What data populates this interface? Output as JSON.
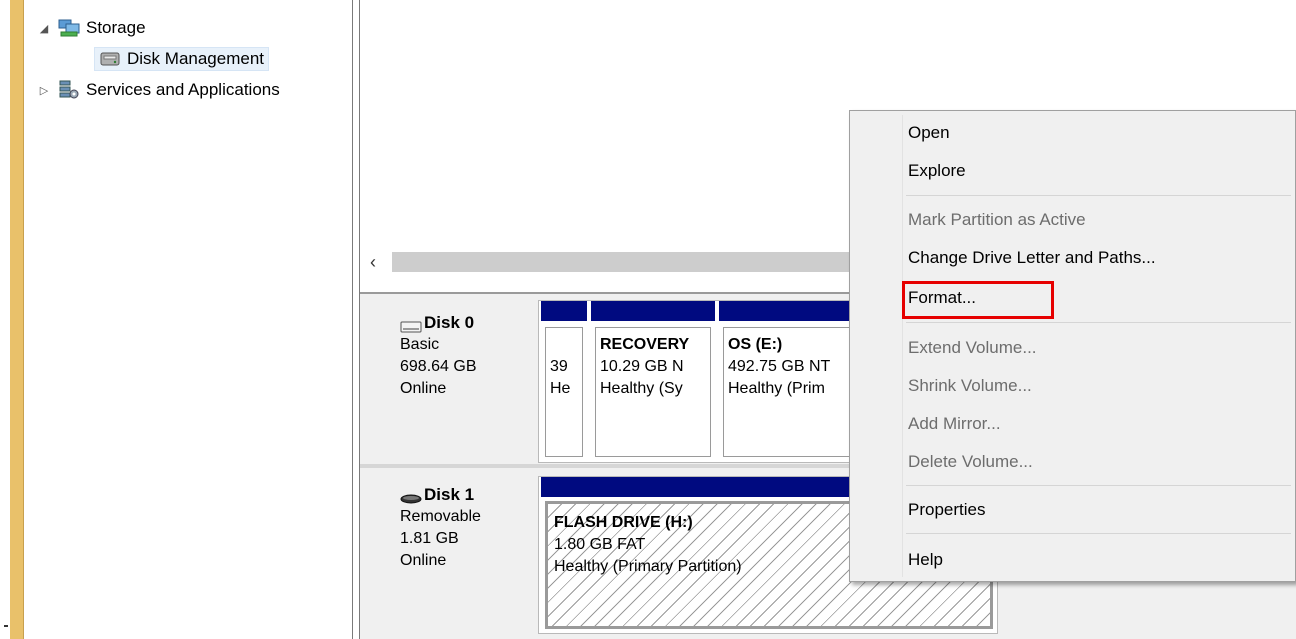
{
  "tree": {
    "items": [
      {
        "label": "Storage",
        "expander": "◢",
        "icon": "storage-icon"
      },
      {
        "label": "Disk Management",
        "icon": "disk-management-icon",
        "selected": true
      },
      {
        "label": "Services and Applications",
        "expander": "▷",
        "icon": "services-icon"
      }
    ]
  },
  "scroll": {
    "left_arrow": "‹"
  },
  "disks": [
    {
      "name": "Disk 0",
      "type": "Basic",
      "size": "698.64 GB",
      "status": "Online",
      "partitions": [
        {
          "line1": "",
          "line2": "39",
          "line3": "He"
        },
        {
          "name": "RECOVERY",
          "line2": "10.29 GB N",
          "line3": "Healthy (Sy"
        },
        {
          "name": "OS  (E:)",
          "line2": "492.75 GB NT",
          "line3": "Healthy (Prim"
        }
      ]
    },
    {
      "name": "Disk 1",
      "type": "Removable",
      "size": "1.81 GB",
      "status": "Online",
      "partitions": [
        {
          "name": "FLASH DRIVE  (H:)",
          "line2": "1.80 GB FAT",
          "line3": "Healthy (Primary Partition)"
        }
      ]
    }
  ],
  "context_menu": {
    "open": "Open",
    "explore": "Explore",
    "mark_active": "Mark Partition as Active",
    "change_letter": "Change Drive Letter and Paths...",
    "format": "Format...",
    "extend": "Extend Volume...",
    "shrink": "Shrink Volume...",
    "add_mirror": "Add Mirror...",
    "delete": "Delete Volume...",
    "properties": "Properties",
    "help": "Help"
  },
  "colors": {
    "partition_bar": "#000a80",
    "highlight": "#e60000",
    "frame": "#e9c16a"
  }
}
